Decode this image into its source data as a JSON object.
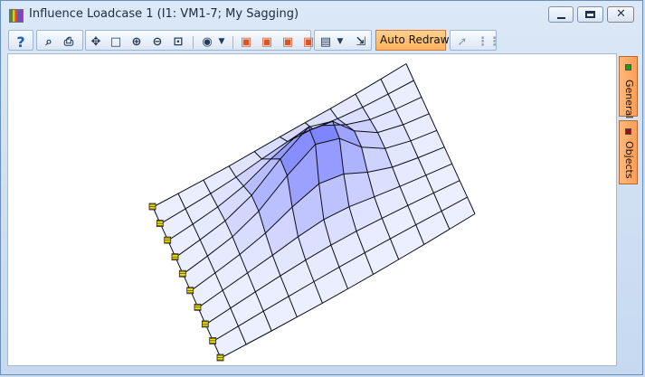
{
  "window": {
    "title": "Influence Loadcase 1 (I1: VM1-7; My Sagging)",
    "icons": [
      "app-icon",
      "minimize-icon",
      "maximize-icon",
      "close-icon"
    ]
  },
  "toolbar": {
    "buttons": [
      {
        "name": "help",
        "icon": "question-icon",
        "label": "?"
      },
      {
        "name": "print-preview",
        "icon": "print-preview-icon",
        "label": "⌕"
      },
      {
        "name": "print",
        "icon": "print-icon",
        "label": "⎙"
      },
      {
        "name": "pan",
        "icon": "move-icon",
        "label": "✥"
      },
      {
        "name": "zoom-window",
        "icon": "zoom-window-icon",
        "label": "□"
      },
      {
        "name": "zoom-in",
        "icon": "zoom-in-icon",
        "label": "⊕"
      },
      {
        "name": "zoom-out",
        "icon": "zoom-out-icon",
        "label": "⊖"
      },
      {
        "name": "zoom-extents",
        "icon": "zoom-extents-icon",
        "label": "⊡"
      },
      {
        "name": "view",
        "icon": "eye-icon",
        "label": "◉"
      },
      {
        "name": "cube-1",
        "icon": "cube-icon",
        "label": "▣"
      },
      {
        "name": "cube-2",
        "icon": "cube-icon",
        "label": "▣"
      },
      {
        "name": "cube-3",
        "icon": "cube-icon",
        "label": "▣"
      },
      {
        "name": "cube-4",
        "icon": "cube-icon",
        "label": "▣"
      },
      {
        "name": "save",
        "icon": "save-icon",
        "label": "▤"
      },
      {
        "name": "export",
        "icon": "export-icon",
        "label": "⇲"
      }
    ],
    "auto_redraw": "Auto Redraw",
    "auto_redraw_active": true,
    "disabled_icons": [
      "pointer-icon",
      "grid-icon"
    ]
  },
  "side_tabs": [
    {
      "label": "General",
      "color": "#1f9b1f"
    },
    {
      "label": "Objects",
      "color": "#8d1414"
    }
  ],
  "colors": {
    "accent": "#ffb35e",
    "mesh_line": "#0b0d12",
    "surface": "#e9ecff",
    "influence": "#7f83ff",
    "support_marker": "#f0e000"
  }
}
